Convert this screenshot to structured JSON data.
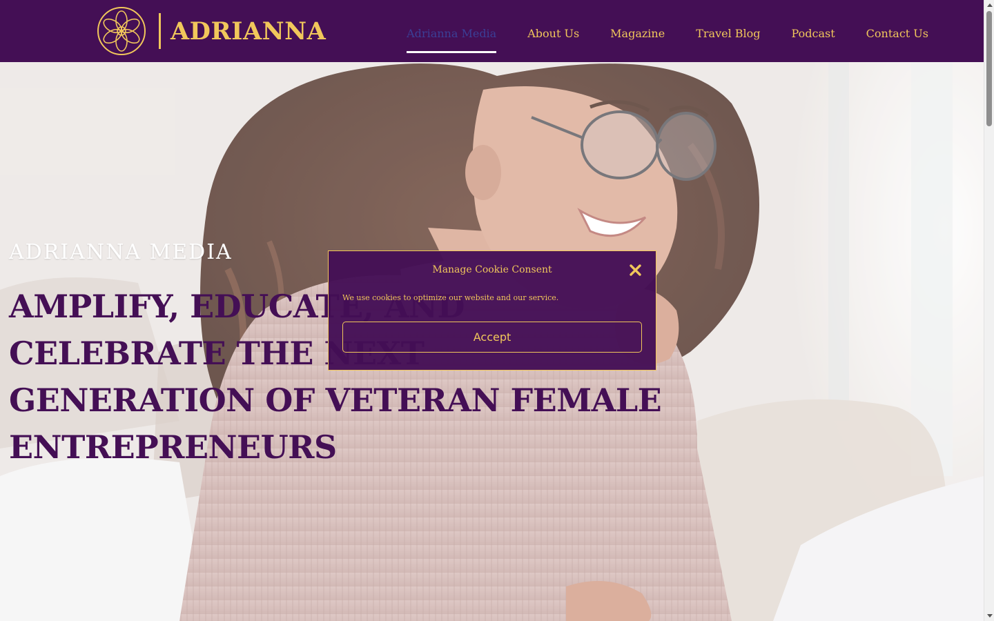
{
  "brand": {
    "name": "ADRIANNA",
    "logo_icon": "floral-knot-emblem",
    "primary_color": "#440f55",
    "accent_color": "#f1c75b"
  },
  "nav": {
    "items": [
      {
        "label": "Adrianna Media",
        "active": true
      },
      {
        "label": "About Us",
        "active": false
      },
      {
        "label": "Magazine",
        "active": false
      },
      {
        "label": "Travel Blog",
        "active": false
      },
      {
        "label": "Podcast",
        "active": false
      },
      {
        "label": "Contact Us",
        "active": false
      }
    ]
  },
  "hero": {
    "eyebrow": "ADRIANNA MEDIA",
    "headline": "AMPLIFY, EDUCATE, AND CELEBRATE THE NEXT GENERATION OF VETERAN FEMALE ENTREPRENEURS",
    "image_description": "smiling woman with curly hair and glasses in a pink knit sweater"
  },
  "cookie_modal": {
    "title": "Manage Cookie Consent",
    "text": "We use cookies to optimize our website and our service.",
    "accept_label": "Accept",
    "close_icon": "close-x-icon"
  }
}
